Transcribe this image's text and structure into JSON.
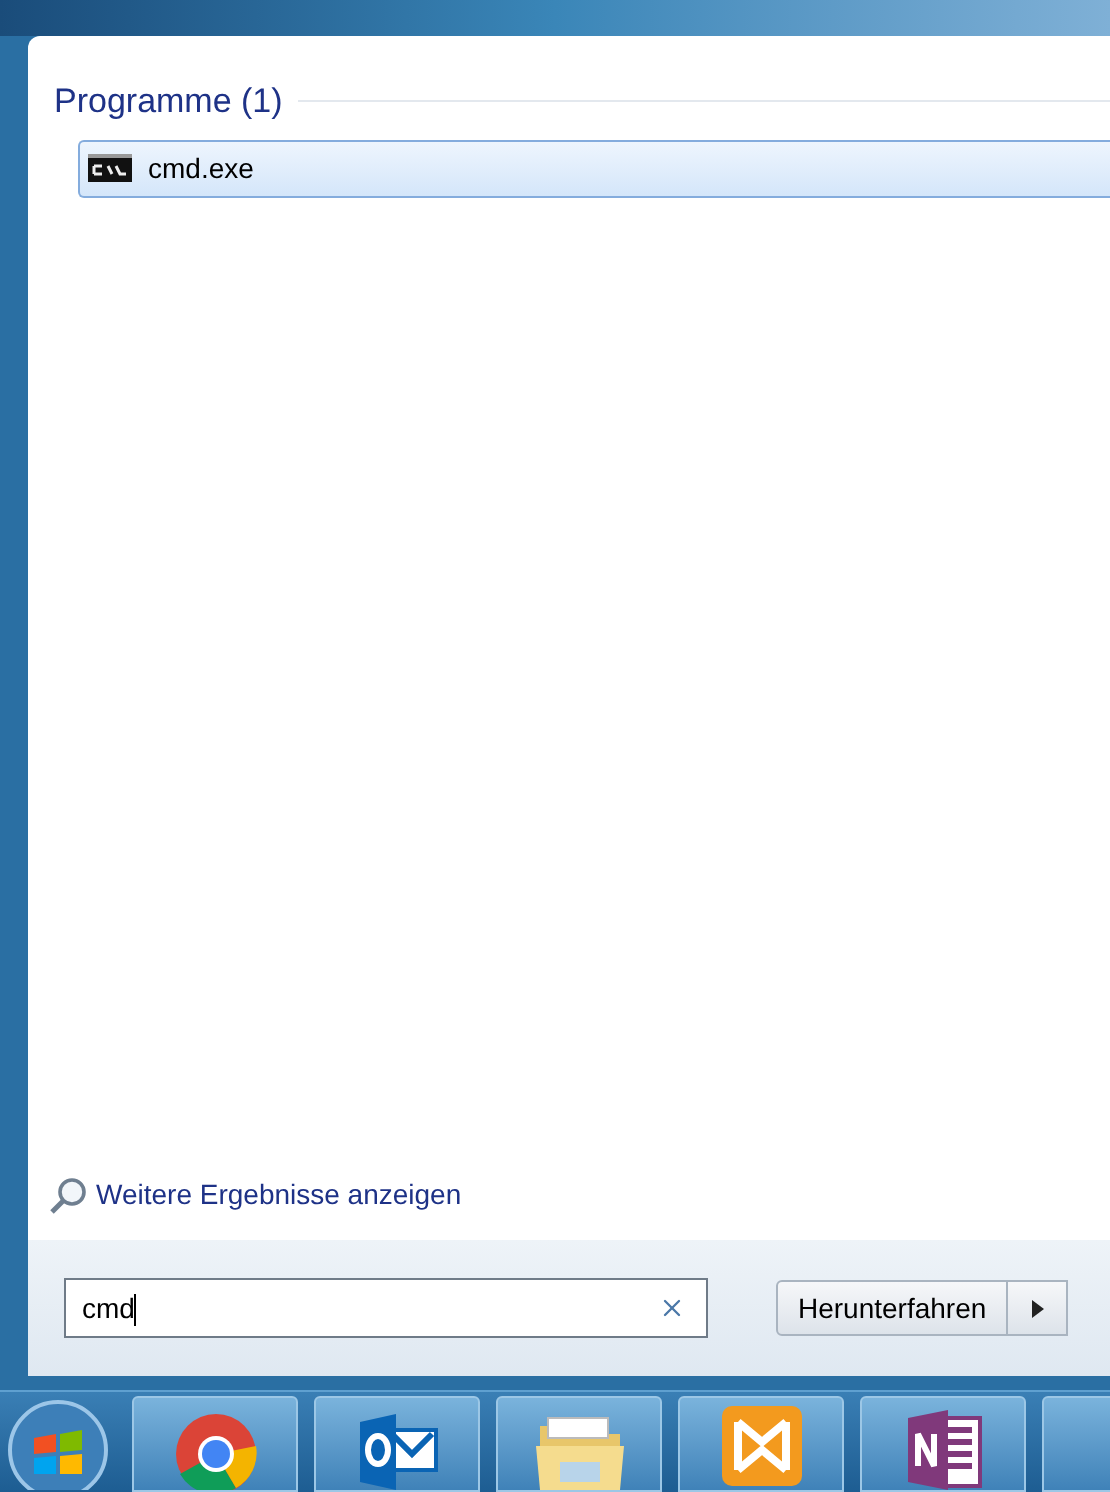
{
  "results": {
    "heading": "Programme (1)",
    "items": [
      {
        "label": "cmd.exe",
        "selected": true
      }
    ]
  },
  "more_results": "Weitere Ergebnisse anzeigen",
  "search": {
    "value": "cmd"
  },
  "shutdown": {
    "label": "Herunterfahren"
  },
  "taskbar": [
    {
      "kind": "start"
    },
    {
      "kind": "chrome"
    },
    {
      "kind": "outlook"
    },
    {
      "kind": "folder"
    },
    {
      "kind": "orange"
    },
    {
      "kind": "onenote"
    },
    {
      "kind": "blank"
    }
  ]
}
